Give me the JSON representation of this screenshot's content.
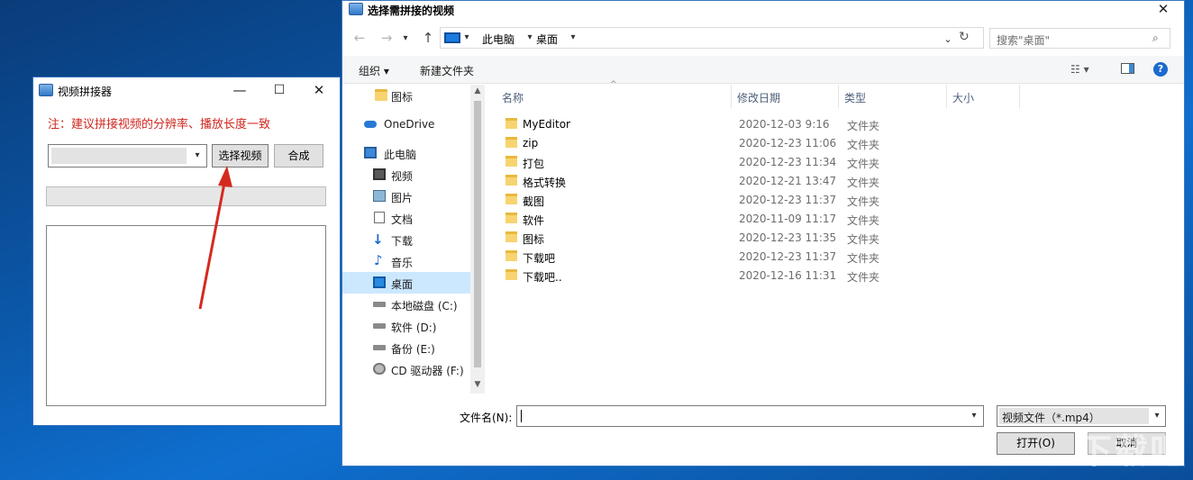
{
  "app": {
    "title": "视频拼接器",
    "notice": "注：建议拼接视频的分辨率、播放长度一致",
    "select_button": "选择视频",
    "merge_button": "合成",
    "minimize": "—",
    "maximize": "☐",
    "close": "✕"
  },
  "dialog": {
    "title": "选择需拼接的视频",
    "close": "✕",
    "breadcrumb": [
      "此电脑",
      "桌面"
    ],
    "search_placeholder": "搜索\"桌面\"",
    "toolbar": {
      "organize": "组织",
      "new_folder": "新建文件夹"
    },
    "nav": [
      {
        "label": "图标",
        "icon": "folder-icon"
      },
      {
        "label": "OneDrive",
        "icon": "onedrive-icon"
      },
      {
        "label": "此电脑",
        "icon": "pc-icon"
      },
      {
        "label": "视频",
        "icon": "video-icon"
      },
      {
        "label": "图片",
        "icon": "picture-icon"
      },
      {
        "label": "文档",
        "icon": "document-icon"
      },
      {
        "label": "下载",
        "icon": "download-icon"
      },
      {
        "label": "音乐",
        "icon": "music-icon"
      },
      {
        "label": "桌面",
        "icon": "desktop-icon",
        "selected": true
      },
      {
        "label": "本地磁盘 (C:)",
        "icon": "drive-icon"
      },
      {
        "label": "软件 (D:)",
        "icon": "drive-icon"
      },
      {
        "label": "备份 (E:)",
        "icon": "drive-icon"
      },
      {
        "label": "CD 驱动器 (F:)",
        "icon": "cd-drive-icon"
      }
    ],
    "columns": {
      "name": "名称",
      "date": "修改日期",
      "type": "类型",
      "size": "大小"
    },
    "files": [
      {
        "name": "MyEditor",
        "date": "2020-12-03 9:16",
        "type": "文件夹"
      },
      {
        "name": "zip",
        "date": "2020-12-23 11:06",
        "type": "文件夹"
      },
      {
        "name": "打包",
        "date": "2020-12-23 11:34",
        "type": "文件夹"
      },
      {
        "name": "格式转换",
        "date": "2020-12-21 13:47",
        "type": "文件夹"
      },
      {
        "name": "截图",
        "date": "2020-12-23 11:37",
        "type": "文件夹"
      },
      {
        "name": "软件",
        "date": "2020-11-09 11:17",
        "type": "文件夹"
      },
      {
        "name": "图标",
        "date": "2020-12-23 11:35",
        "type": "文件夹"
      },
      {
        "name": "下载吧",
        "date": "2020-12-23 11:37",
        "type": "文件夹"
      },
      {
        "name": "下载吧..",
        "date": "2020-12-16 11:31",
        "type": "文件夹"
      }
    ],
    "filename_label": "文件名(N):",
    "filename_value": "",
    "filter": "视频文件（*.mp4）",
    "open_button": "打开(O)",
    "cancel_button": "取消"
  },
  "watermark": "下载吧",
  "colors": {
    "accent": "#0078d7",
    "notice": "#d0261e",
    "selection": "#cce8ff"
  }
}
